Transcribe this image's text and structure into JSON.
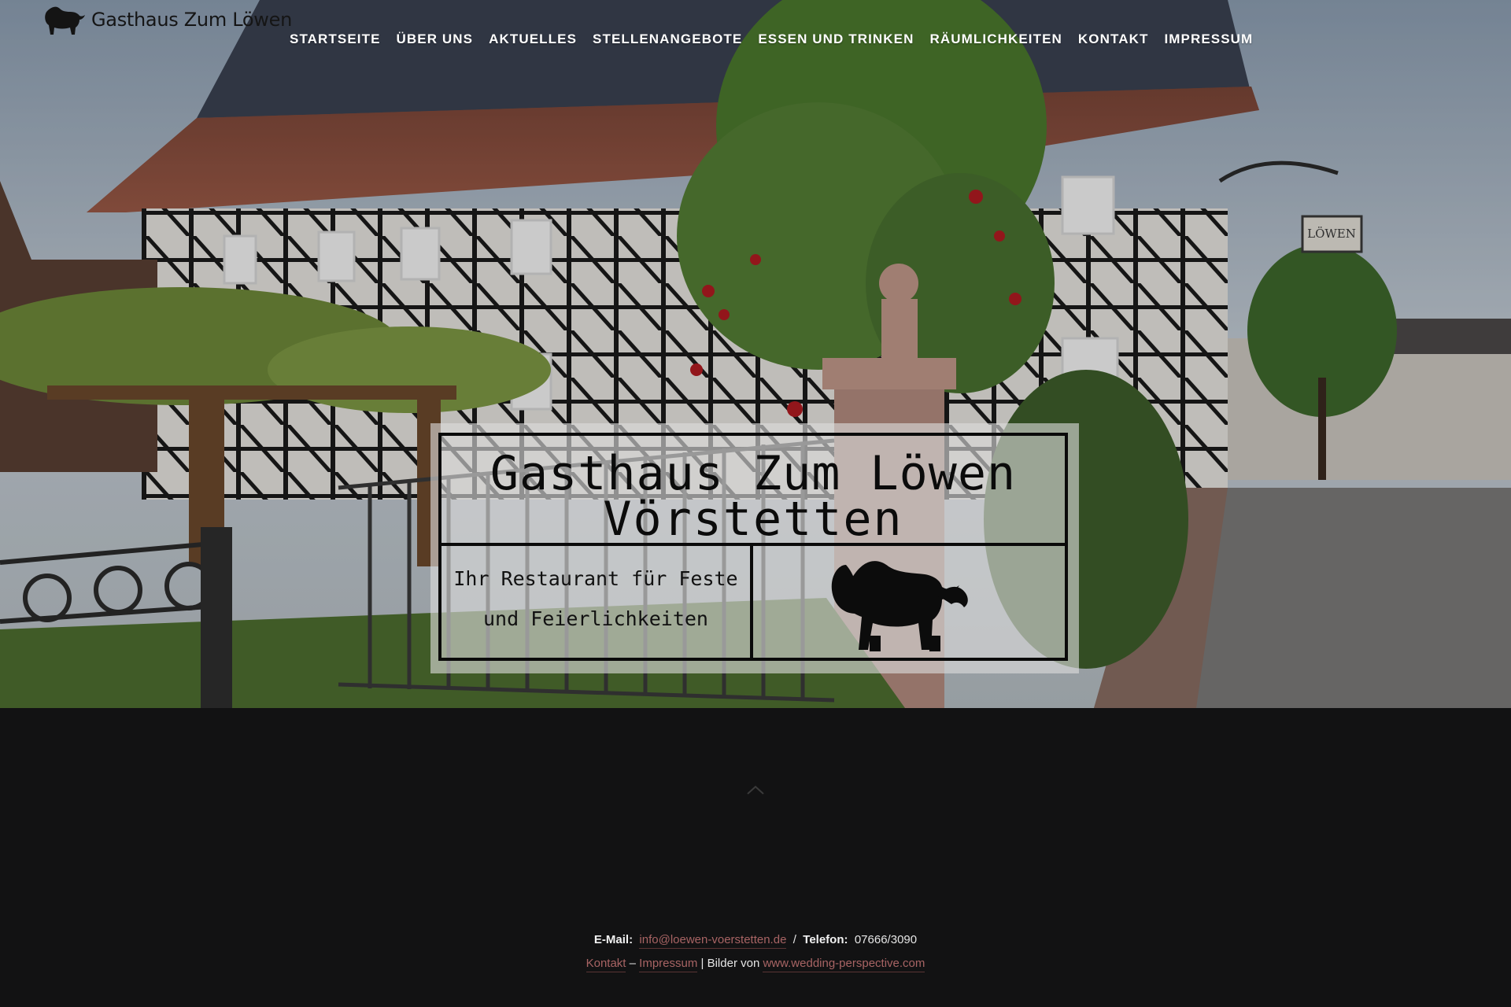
{
  "header": {
    "logo_text": "Gasthaus Zum Löwen",
    "nav": [
      {
        "label": "STARTSEITE"
      },
      {
        "label": "ÜBER UNS"
      },
      {
        "label": "AKTUELLES"
      },
      {
        "label": "STELLENANGEBOTE"
      },
      {
        "label": "ESSEN UND TRINKEN"
      },
      {
        "label": "RÄUMLICHKEITEN"
      },
      {
        "label": "KONTAKT"
      },
      {
        "label": "IMPRESSUM"
      }
    ]
  },
  "hero": {
    "title_line1": "Gasthaus Zum Löwen",
    "title_line2": "Vörstetten",
    "tagline_line1": "Ihr Restaurant für Feste",
    "tagline_line2": "und Feierlichkeiten",
    "sign_text": "LÖWEN"
  },
  "footer": {
    "email_label": "E-Mail:",
    "email": "info@loewen-voerstetten.de",
    "separator": "/",
    "phone_label": "Telefon:",
    "phone": "07666/3090",
    "link_kontakt": "Kontakt",
    "dash": "–",
    "link_impressum": "Impressum",
    "credit_text": "| Bilder von",
    "credit_link": "www.wedding-perspective.com"
  },
  "colors": {
    "background": "#121213",
    "link": "#a86464",
    "nav_text": "#ffffff"
  },
  "icons": {
    "logo": "lion-icon",
    "scroll_top": "chevron-up-icon"
  }
}
